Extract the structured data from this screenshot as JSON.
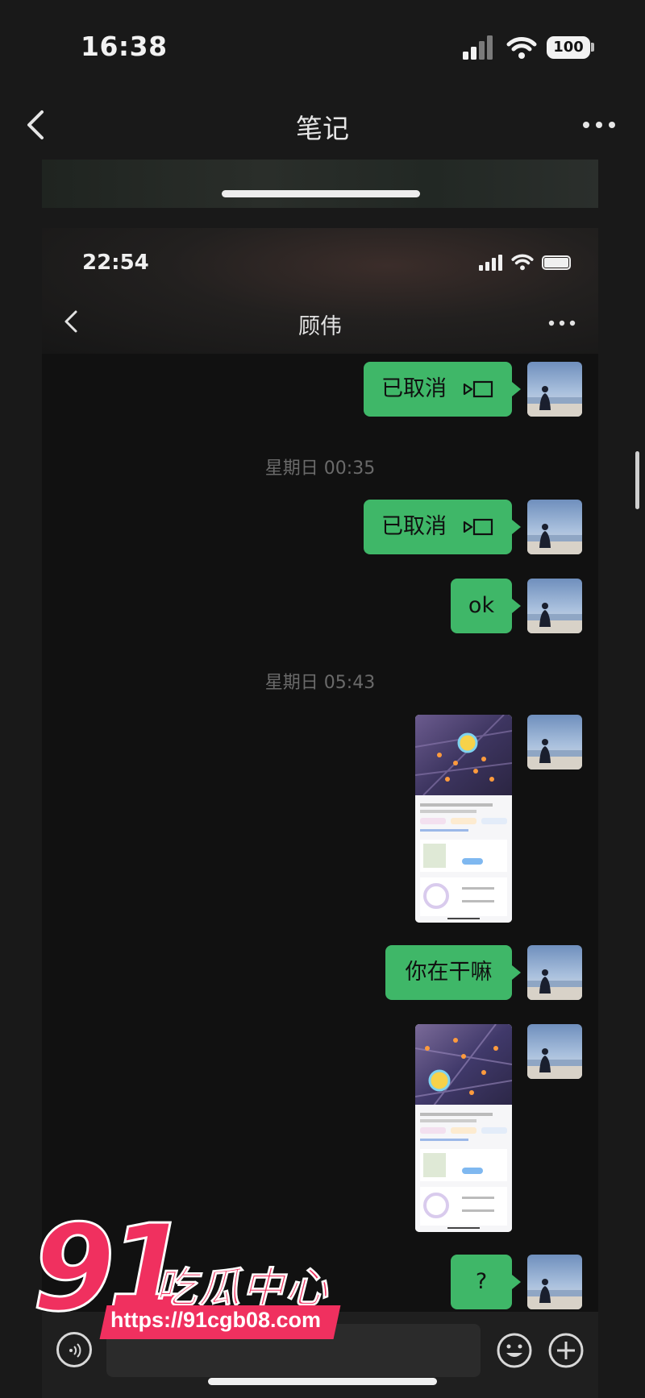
{
  "outer": {
    "status": {
      "time": "16:38",
      "battery": "100"
    },
    "nav": {
      "title": "笔记"
    }
  },
  "inner": {
    "status": {
      "time": "22:54"
    },
    "nav": {
      "title": "顾伟"
    },
    "messages": [
      {
        "type": "text",
        "text": "已取消",
        "icon": "video-call-icon"
      },
      {
        "type": "timestamp",
        "text": "星期日 00:35"
      },
      {
        "type": "text",
        "text": "已取消",
        "icon": "video-call-icon"
      },
      {
        "type": "text",
        "text": "ok"
      },
      {
        "type": "timestamp",
        "text": "星期日 05:43"
      },
      {
        "type": "image"
      },
      {
        "type": "text",
        "text": "你在干嘛"
      },
      {
        "type": "image"
      },
      {
        "type": "text",
        "text": "?"
      }
    ]
  },
  "watermark": {
    "number": "91",
    "text": "吃瓜中心",
    "url": "https://91cgb08.com"
  },
  "colors": {
    "bubble": "#3fb768",
    "background": "#111111",
    "watermark": "#f0305f"
  }
}
